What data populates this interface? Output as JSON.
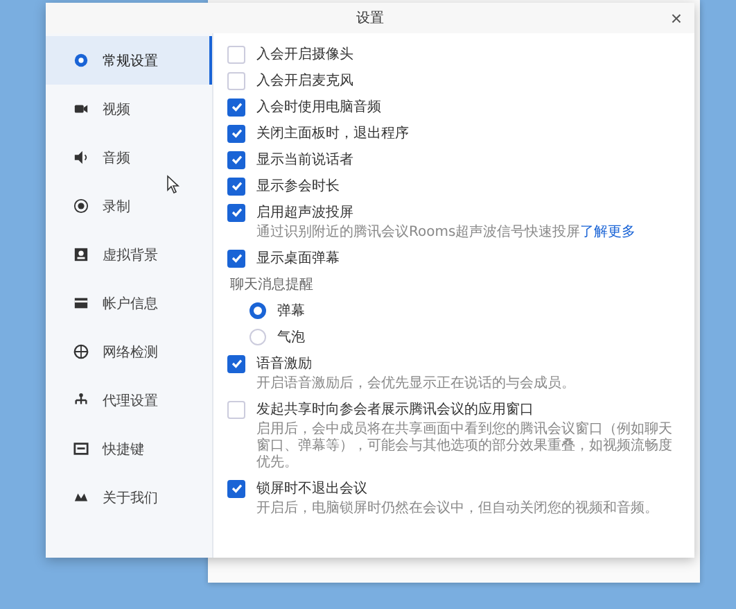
{
  "window": {
    "title": "设置",
    "close": "×"
  },
  "sidebar": {
    "items": [
      {
        "label": "常规设置",
        "selected": true
      },
      {
        "label": "视频",
        "selected": false
      },
      {
        "label": "音频",
        "selected": false
      },
      {
        "label": "录制",
        "selected": false
      },
      {
        "label": "虚拟背景",
        "selected": false
      },
      {
        "label": "帐户信息",
        "selected": false
      },
      {
        "label": "网络检测",
        "selected": false
      },
      {
        "label": "代理设置",
        "selected": false
      },
      {
        "label": "快捷键",
        "selected": false
      },
      {
        "label": "关于我们",
        "selected": false
      }
    ]
  },
  "settings": [
    {
      "kind": "checkbox",
      "label": "入会开启摄像头",
      "checked": false
    },
    {
      "kind": "checkbox",
      "label": "入会开启麦克风",
      "checked": false
    },
    {
      "kind": "checkbox",
      "label": "入会时使用电脑音频",
      "checked": true
    },
    {
      "kind": "checkbox",
      "label": "关闭主面板时，退出程序",
      "checked": true
    },
    {
      "kind": "checkbox",
      "label": "显示当前说话者",
      "checked": true
    },
    {
      "kind": "checkbox",
      "label": "显示参会时长",
      "checked": true
    },
    {
      "kind": "checkbox",
      "label": "启用超声波投屏",
      "checked": true,
      "description": "通过识别附近的腾讯会议Rooms超声波信号快速投屏",
      "link": "了解更多"
    },
    {
      "kind": "checkbox",
      "label": "显示桌面弹幕",
      "checked": true
    },
    {
      "kind": "heading",
      "label": "聊天消息提醒"
    },
    {
      "kind": "radio",
      "label": "弹幕",
      "selected": true
    },
    {
      "kind": "radio",
      "label": "气泡",
      "selected": false
    },
    {
      "kind": "checkbox",
      "label": "语音激励",
      "checked": true,
      "description": "开启语音激励后，会优先显示正在说话的与会成员。"
    },
    {
      "kind": "checkbox",
      "label": "发起共享时向参会者展示腾讯会议的应用窗口",
      "checked": false,
      "description": "启用后，会中成员将在共享画面中看到您的腾讯会议窗口（例如聊天窗口、弹幕等），可能会与其他选项的部分效果重叠，如视频流畅度优先。"
    },
    {
      "kind": "checkbox",
      "label": "锁屏时不退出会议",
      "checked": true,
      "description": "开启后，电脑锁屏时仍然在会议中，但自动关闭您的视频和音频。"
    }
  ]
}
